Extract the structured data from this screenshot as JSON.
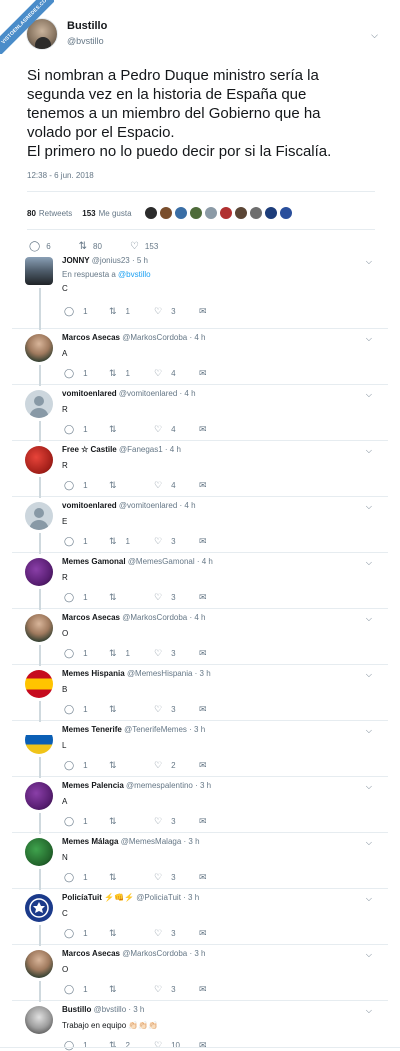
{
  "watermark": {
    "text": "VISTOENLASREDES.COM"
  },
  "tweet": {
    "author_name": "Bustillo",
    "author_handle": "@bvstillo",
    "text_lines": [
      "Si nombran a Pedro Duque ministro sería la",
      "segunda vez en la historia de España que",
      "tenemos a un miembro del Gobierno que ha",
      "volado por el Espacio.",
      "El primero no lo puedo decir por si la Fiscalía."
    ],
    "timestamp": "12:38 - 6 jun. 2018",
    "retweets_count": "80",
    "retweets_label": "Retweets",
    "likes_count": "153",
    "likes_label": "Me gusta",
    "actions": {
      "replies": "6",
      "retweets": "80",
      "likes": "153"
    }
  },
  "likers_colors": [
    "#2b2b2b",
    "#7a4e2d",
    "#3a6ea5",
    "#4e6b3a",
    "#8b9aa6",
    "#b03030",
    "#5b4636",
    "#6e6e6e",
    "#1d3d7a",
    "#2a4f9c"
  ],
  "replies": [
    {
      "name": "JONNY",
      "handle": "@jonius23 · 5 h",
      "in_reply_label": "En respuesta a ",
      "in_reply_handle": "@bvstillo",
      "text": "C",
      "replies": "1",
      "retweets": "1",
      "likes": "3",
      "avatar": "photo-dark"
    },
    {
      "name": "Marcos Asecas",
      "handle": "@MarkosCordoba · 4 h",
      "text": "A",
      "replies": "1",
      "retweets": "1",
      "likes": "4",
      "avatar": "photo-man"
    },
    {
      "name": "vomitoenlared",
      "handle": "@vomitoenlared · 4 h",
      "text": "R",
      "replies": "1",
      "retweets": "",
      "likes": "4",
      "avatar": "default"
    },
    {
      "name": "Free ☆ Castile",
      "handle": "@Fanegas1 · 4 h",
      "text": "R",
      "replies": "1",
      "retweets": "",
      "likes": "4",
      "avatar": "ball-red"
    },
    {
      "name": "vomitoenlared",
      "handle": "@vomitoenlared · 4 h",
      "text": "E",
      "replies": "1",
      "retweets": "1",
      "likes": "3",
      "avatar": "default"
    },
    {
      "name": "Memes Gamonal",
      "handle": "@MemesGamonal · 4 h",
      "text": "R",
      "replies": "1",
      "retweets": "",
      "likes": "3",
      "avatar": "ball-purple"
    },
    {
      "name": "Marcos Asecas",
      "handle": "@MarkosCordoba · 4 h",
      "text": "O",
      "replies": "1",
      "retweets": "1",
      "likes": "3",
      "avatar": "photo-man"
    },
    {
      "name": "Memes Hispania",
      "handle": "@MemesHispania · 3 h",
      "text": "B",
      "replies": "1",
      "retweets": "",
      "likes": "3",
      "avatar": "ball-spain"
    },
    {
      "name": "Memes Tenerife",
      "handle": "@TenerifeMemes · 3 h",
      "text": "L",
      "replies": "1",
      "retweets": "",
      "likes": "2",
      "avatar": "ball-blue"
    },
    {
      "name": "Memes Palencia",
      "handle": "@memespalentino · 3 h",
      "text": "A",
      "replies": "1",
      "retweets": "",
      "likes": "3",
      "avatar": "ball-purple"
    },
    {
      "name": "Memes Málaga",
      "handle": "@MemesMalaga · 3 h",
      "text": "N",
      "replies": "1",
      "retweets": "",
      "likes": "3",
      "avatar": "ball-green"
    },
    {
      "name": "PolicíaTuit ⚡👊⚡",
      "handle": "@PoliciaTuit · 3 h",
      "text": "C",
      "replies": "1",
      "retweets": "",
      "likes": "3",
      "avatar": "police"
    },
    {
      "name": "Marcos Asecas",
      "handle": "@MarkosCordoba · 3 h",
      "text": "O",
      "replies": "1",
      "retweets": "",
      "likes": "3",
      "avatar": "photo-man"
    },
    {
      "name": "Bustillo",
      "handle": "@bvstillo · 3 h",
      "text": "Trabajo en equipo 👏🏻👏🏻👏🏻",
      "replies": "1",
      "retweets": "2",
      "likes": "10",
      "avatar": "photo-bald"
    }
  ]
}
